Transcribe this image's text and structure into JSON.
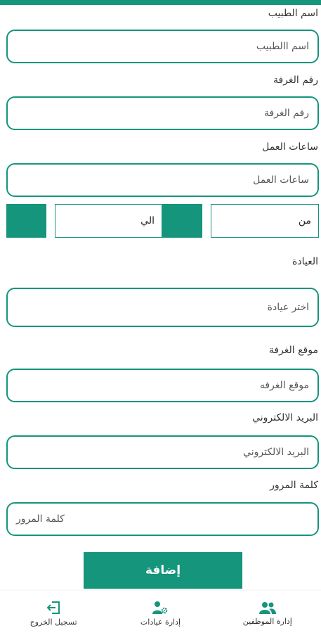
{
  "colors": {
    "accent": "#14957c"
  },
  "form": {
    "doctor_name": {
      "label": "اسم الطبيب",
      "placeholder": "اسم االطبيب"
    },
    "room_number": {
      "label": "رقم الغرفة",
      "placeholder": "رقم الغرفة"
    },
    "work_hours": {
      "label": "ساعات العمل",
      "placeholder": "ساعات العمل"
    },
    "hours_range": {
      "from_label": "من",
      "to_label": "الي"
    },
    "clinic": {
      "label": "العيادة",
      "placeholder": "اختر عيادة"
    },
    "room_location": {
      "label": "موقع الغرفة",
      "placeholder": "موقع الغرفه"
    },
    "email": {
      "label": "البريد الالكتروني",
      "placeholder": "البريد الالكتروني"
    },
    "password": {
      "label": "كلمة المرور",
      "placeholder": "كلمة المرور"
    },
    "submit_label": "إضافة"
  },
  "bottom_nav": {
    "items": [
      {
        "label": "تسجيل الخروج",
        "icon": "logout-icon"
      },
      {
        "label": "إدارة عيادات",
        "icon": "user-gear-icon"
      },
      {
        "label": "إدارة الموظفين",
        "icon": "users-icon"
      }
    ]
  }
}
